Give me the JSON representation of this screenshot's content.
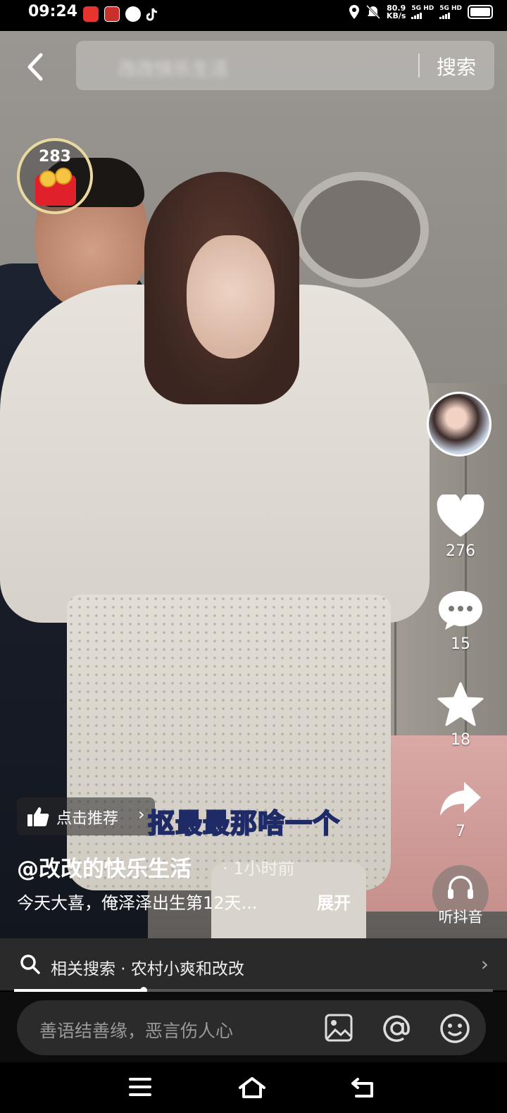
{
  "status_bar": {
    "time": "09:24",
    "net_speed": "80.9",
    "net_speed_unit": "KB/s",
    "net_1": "5G HD",
    "net_2": "5G HD"
  },
  "top_bar": {
    "search_query_blurred": "改改快乐生活",
    "search_button": "搜索"
  },
  "coin_badge": {
    "count": "283"
  },
  "actions": {
    "likes": "276",
    "comments": "15",
    "favorites": "18",
    "shares": "7"
  },
  "overlay": {
    "recommend_label": "点击推荐",
    "recommend_chevron": "›",
    "caption": "抠最最那啥一个",
    "author": "@改改的快乐生活",
    "post_time": "· 1小时前",
    "description": "今天大喜，俺泽泽出生第12天...",
    "expand": "展开",
    "listen_label": "听抖音"
  },
  "related_search": {
    "label": "相关搜索 · 农村小爽和改改",
    "chevron": "›"
  },
  "progress": {
    "fraction": 0.27
  },
  "comment": {
    "placeholder": "善语结善缘，恶言伤人心"
  },
  "icons": {
    "back": "chevron-left-icon",
    "like": "heart-icon",
    "comment": "comment-bubble-icon",
    "favorite": "star-icon",
    "share": "share-arrow-icon",
    "listen": "headphones-icon",
    "search": "search-icon",
    "image": "image-icon",
    "mention": "at-icon",
    "emoji": "emoji-icon"
  }
}
